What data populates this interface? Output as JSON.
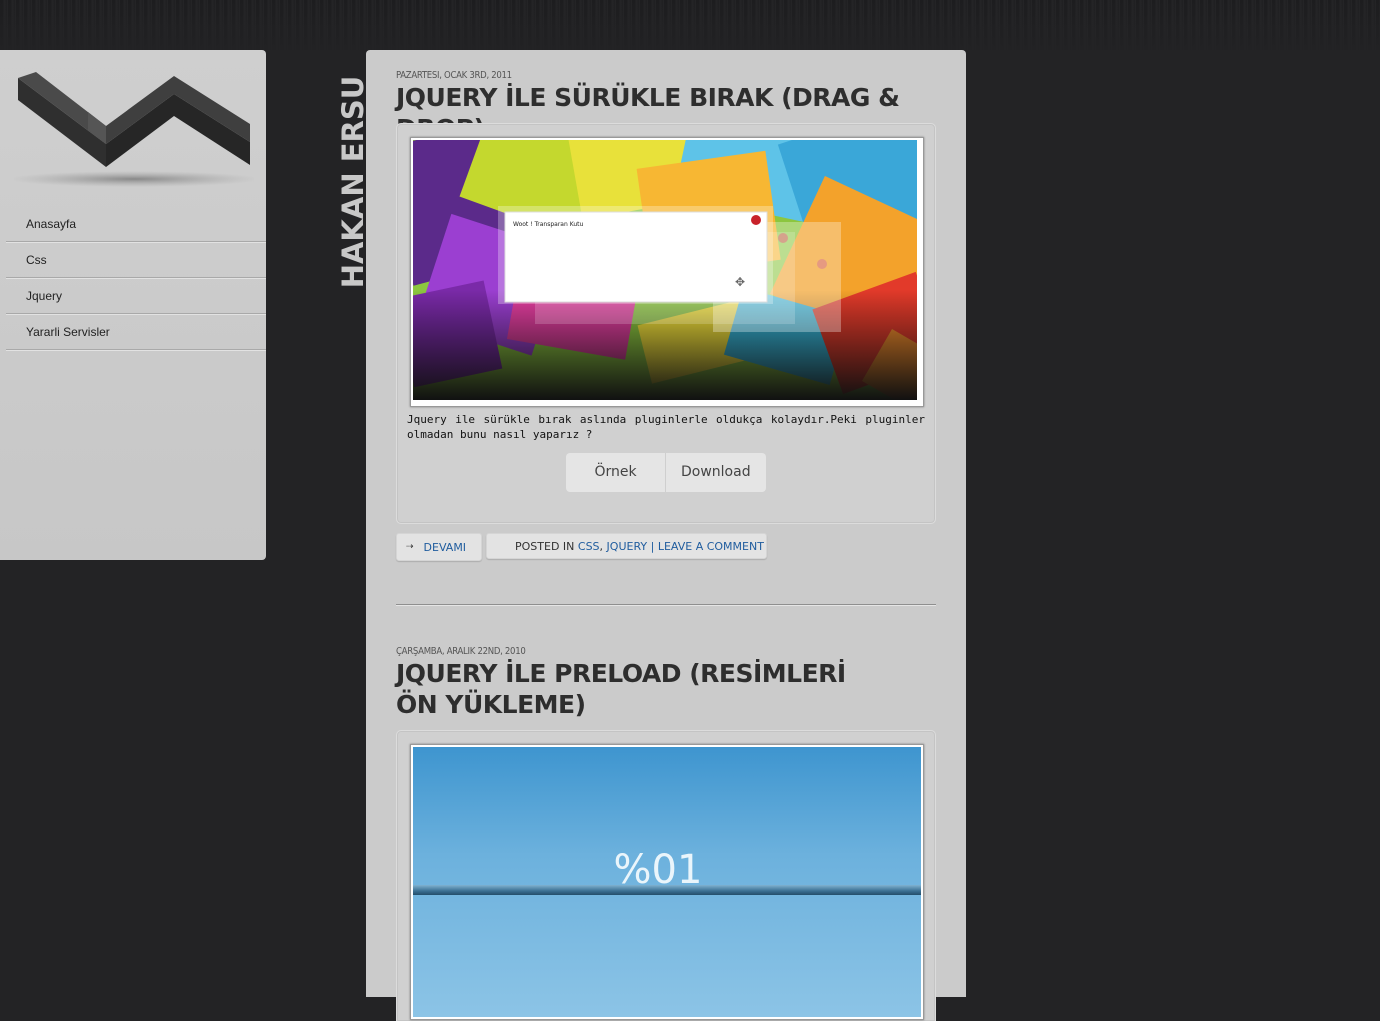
{
  "site": {
    "title": "HAKAN ERSU"
  },
  "nav": {
    "items": [
      {
        "label": "Anasayfa"
      },
      {
        "label": "Css"
      },
      {
        "label": "Jquery"
      },
      {
        "label": "Yararli Servisler"
      }
    ]
  },
  "posts": [
    {
      "date": "Pazartesi, Ocak 3rd, 2011",
      "title": "JQUERY İLE SÜRÜKLE BIRAK (DRAG & DROP)",
      "image": {
        "dialog_title": "Woot ! Transparan Kutu"
      },
      "excerpt": "Jquery ile sürükle bırak aslında pluginlerle oldukça kolaydır.Peki pluginler olmadan bunu nasıl yaparız ?",
      "buttons": {
        "demo": "Örnek",
        "download": "Download"
      },
      "meta": {
        "more": "Devami",
        "posted_in": "Posted in",
        "category_1": "Css",
        "comma": ",",
        "category_2": "Jquery",
        "separator": "|",
        "comment": "Leave a comment"
      }
    },
    {
      "date": "Çarşamba, Aralık 22nd, 2010",
      "title": "JQUERY İLE PRELOAD (RESİMLERİ ÖN YÜKLEME)",
      "image": {
        "percent": "%01"
      }
    }
  ],
  "colors": {
    "page_bg": "#232325",
    "panel_bg": "#cbcbcb",
    "link": "#1f5c9e"
  }
}
